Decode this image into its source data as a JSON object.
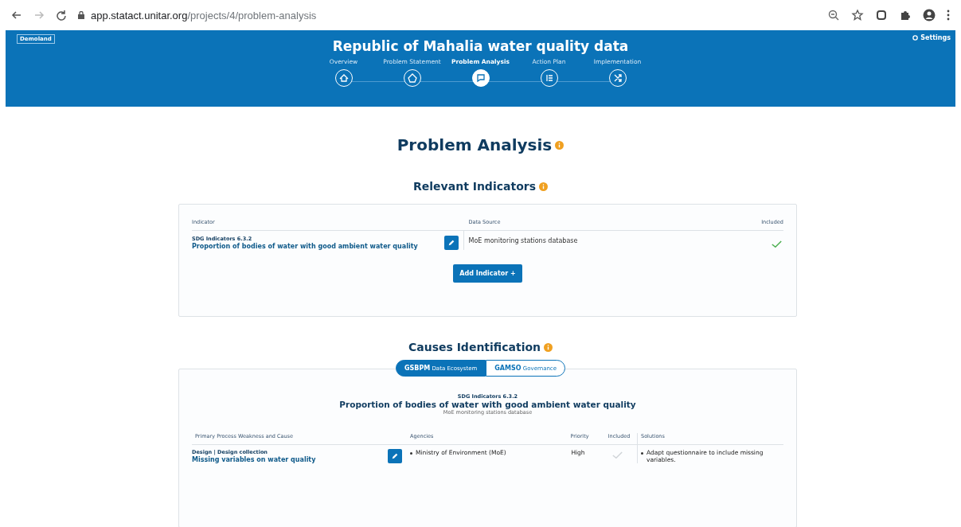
{
  "browser": {
    "url_host": "app.statact.unitar.org",
    "url_path": "/projects/4/problem-analysis"
  },
  "header": {
    "badge": "Demoland",
    "title": "Republic of Mahalia water quality data",
    "settings": "Settings",
    "steps": [
      {
        "label": "Overview",
        "selected": false
      },
      {
        "label": "Problem Statement",
        "selected": false
      },
      {
        "label": "Problem Analysis",
        "selected": true
      },
      {
        "label": "Action Plan",
        "selected": false
      },
      {
        "label": "Implementation",
        "selected": false
      }
    ]
  },
  "page_title": "Problem Analysis",
  "indicators": {
    "heading": "Relevant Indicators",
    "columns": [
      "Indicator",
      "Data Source",
      "Included"
    ],
    "rows": [
      {
        "code": "SDG Indicators 6.3.2",
        "name": "Proportion of bodies of water with good ambient water quality",
        "source": "MoE monitoring stations database",
        "included": true
      }
    ],
    "add_button": "Add Indicator +"
  },
  "causes": {
    "heading": "Causes Identification",
    "tabs": [
      {
        "code": "GSBPM",
        "label": "Data Ecosystem",
        "selected": true
      },
      {
        "code": "GAMSO",
        "label": "Governance",
        "selected": false
      }
    ],
    "indicator_code": "SDG Indicators 6.3.2",
    "indicator_name": "Proportion of bodies of water with good ambient water quality",
    "indicator_source": "MoE monitoring stations database",
    "columns": [
      "Primary Process Weakness and Cause",
      "Agencies",
      "Priority",
      "Included",
      "Solutions"
    ],
    "rows": [
      {
        "process": "Design | Design collection",
        "weakness": "Missing variables on water quality",
        "agency": "Ministry of Environment (MoE)",
        "priority": "High",
        "included": false,
        "solution": "Adapt questionnaire to include missing variables."
      }
    ]
  }
}
